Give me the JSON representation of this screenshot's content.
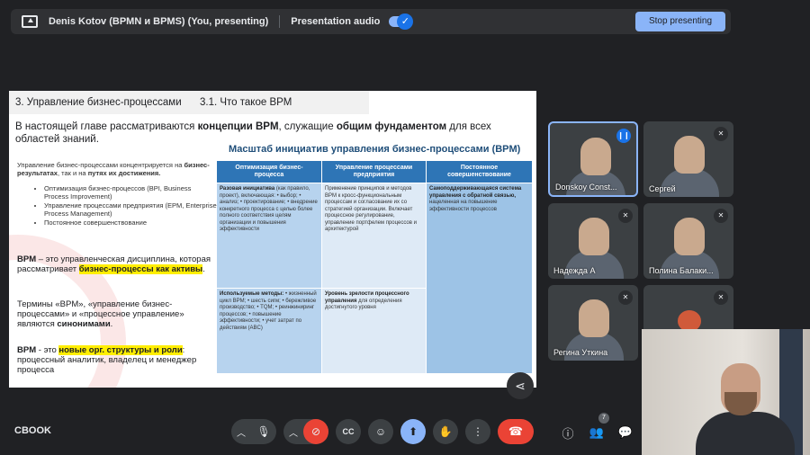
{
  "topbar": {
    "title": "Denis Kotov (BPMN и BPMS) (You, presenting)",
    "audio_label": "Presentation audio",
    "stop_label": "Stop presenting"
  },
  "slide": {
    "section": "3. Управление бизнес-процессами",
    "subsection": "3.1. Что такое BPM",
    "intro_1": "В настоящей главе рассматриваются ",
    "intro_b1": "концепции BPM",
    "intro_2": ", служащие ",
    "intro_b2": "общим фундаментом",
    "intro_3": " для всех областей знаний.",
    "left_text_1": "Управление бизнес-процессами концентрируется на ",
    "left_b1": "бизнес-результатах",
    "left_text_2": ", так и на ",
    "left_b2": "путях их достижения.",
    "bullets": [
      "Оптимизация бизнес-процессов (BPI, Business Process Improvement)",
      "Управление процессами предприятия (EPM, Enterprise Process Management)",
      "Постоянное совершенствование"
    ],
    "def1_a": "BPM",
    "def1_b": " – это управленческая дисциплина, которая рассматривает ",
    "def1_hl": "бизнес-процессы как активы",
    "def1_c": ".",
    "def2_a": "Термины «BPM», «управление бизнес-процессами» и «процессное управление» являются ",
    "def2_b": "синонимами",
    "def2_c": ".",
    "def3_a": "BPM",
    "def3_b": " - это ",
    "def3_hl": "новые орг. структуры и роли",
    "def3_c": ": процессный аналитик, владелец и менеджер процесса",
    "table_title": "Масштаб инициатив управления бизнес-процессами (BPM)",
    "col_heads": [
      "Оптимизация бизнес-процесса",
      "Управление процессами предприятия",
      "Постоянное совершенствование"
    ],
    "cell_1_1_b": "Разовая инициатива",
    "cell_1_1": "(как правило, проект), включающая: • выбор; • анализ; • проектирование; • внедрение конкретного процесса с целью более полного соответствия целям организации и повышения эффективности",
    "cell_1_2": "Применение принципов и методов BPM к кросс-функциональным процессам и согласование их со стратегией организации. Включает процессное регулирование, управление портфелем процессов и архитектурой",
    "cell_1_3_b": "Самоподдерживающаяся система управления с обратной связью,",
    "cell_1_3": " нацеленная на повышение эффективности процессов",
    "cell_2_1_b": "Используемые методы:",
    "cell_2_1": "• жизненный цикл BPM; • шесть сигм; • бережливое производство; • TQM; • реинжиниринг процессов; • повышение эффективности; • учет затрат по действиям (ABC)",
    "cell_2_2_b": "Уровень зрелости процессного управления",
    "cell_2_2": " для определения достигнутого уровня"
  },
  "participants": [
    {
      "name": "Donskoy Const...",
      "status": "speaking"
    },
    {
      "name": "Сергей",
      "status": "muted"
    },
    {
      "name": "Надежда А",
      "status": "muted"
    },
    {
      "name": "Полина Балаки...",
      "status": "muted"
    },
    {
      "name": "Регина Уткина",
      "status": "muted"
    },
    {
      "name": "",
      "status": "muted"
    }
  ],
  "meeting_code": "CBOOK",
  "people_count": "7",
  "colors": {
    "accent": "#8ab4f8",
    "end_call": "#ea4335",
    "table_head": "#2e75b6",
    "highlight": "#ffee00"
  }
}
